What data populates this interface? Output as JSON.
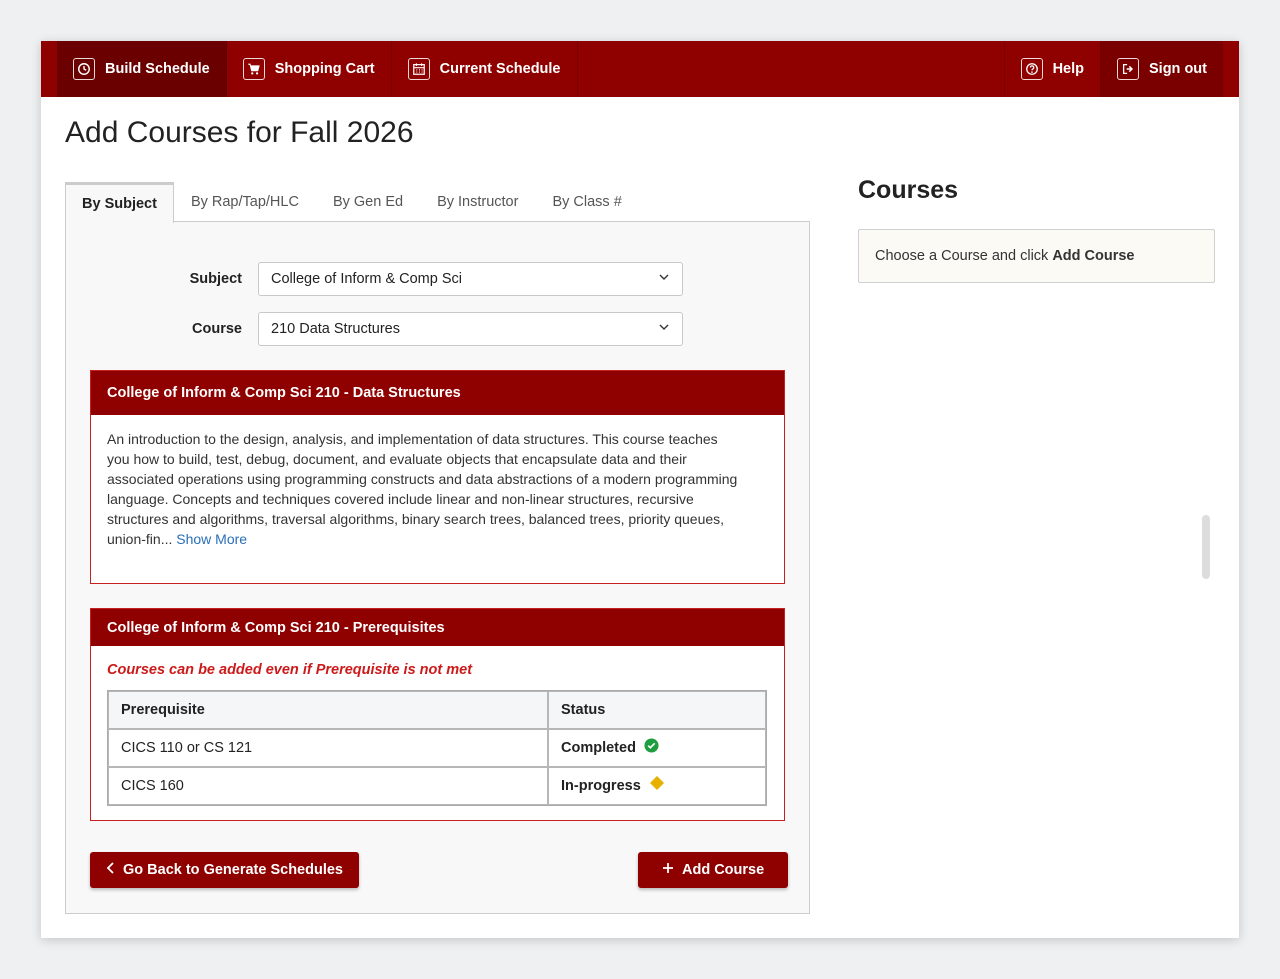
{
  "nav": {
    "build_schedule": "Build Schedule",
    "shopping_cart": "Shopping Cart",
    "current_schedule": "Current Schedule",
    "help": "Help",
    "sign_out": "Sign out"
  },
  "page_title": "Add Courses for Fall 2026",
  "tabs": [
    "By Subject",
    "By Rap/Tap/HLC",
    "By Gen Ed",
    "By Instructor",
    "By Class #"
  ],
  "form": {
    "subject_label": "Subject",
    "subject_value": "College of Inform & Comp Sci",
    "course_label": "Course",
    "course_value": "210 Data Structures"
  },
  "description": {
    "heading": "College of Inform & Comp Sci 210 - Data Structures",
    "text": "An introduction to the design, analysis, and implementation of data structures. This course teaches you how to build, test, debug, document, and evaluate objects that encapsulate data and their associated operations using programming constructs and data abstractions of a modern programming language. Concepts and techniques covered include linear and non-linear structures, recursive structures and algorithms, traversal algorithms, binary search trees, balanced trees, priority queues, union-fin...",
    "show_more": "Show More"
  },
  "prereq": {
    "heading": "College of Inform & Comp Sci 210 - Prerequisites",
    "warning": "Courses can be added even if Prerequisite is not met",
    "col_prereq": "Prerequisite",
    "col_status": "Status",
    "rows": [
      {
        "name": "CICS 110 or CS 121",
        "status": "Completed",
        "status_icon": "check-circle-icon",
        "status_color": "#1e9e3e"
      },
      {
        "name": "CICS 160",
        "status": "In-progress",
        "status_icon": "diamond-icon",
        "status_color": "#e8b000"
      }
    ]
  },
  "buttons": {
    "go_back": "Go Back to Generate Schedules",
    "add_course": "Add Course"
  },
  "courses_panel": {
    "title": "Courses",
    "hint_prefix": "Choose a Course and click ",
    "hint_bold": "Add Course"
  },
  "colors": {
    "brand": "#8f0000",
    "link": "#2a6fb8",
    "warning": "#cc1a1a"
  }
}
